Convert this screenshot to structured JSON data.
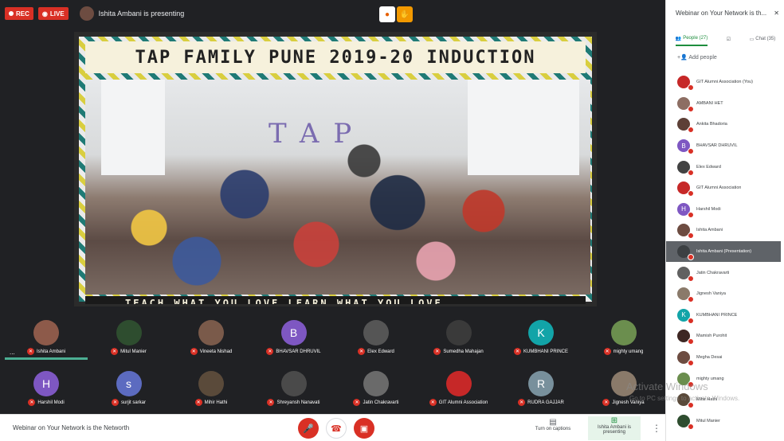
{
  "topbar": {
    "rec_label": "REC",
    "live_label": "LIVE",
    "presenter_text": "Ishita Ambani is presenting"
  },
  "slide": {
    "title": "TAP FAMILY PUNE 2019-20 INDUCTION",
    "footer": "TEACH WHAT YOU LOVE    LEARN WHAT YOU LOVE",
    "photo_sign": "TAP"
  },
  "filmstrip": {
    "row1": [
      {
        "name": "Ishita Ambani",
        "initial": "",
        "color": "#8d5a4a"
      },
      {
        "name": "Mitul Manier",
        "initial": "",
        "color": "#2e4d2f"
      },
      {
        "name": "Vineeta Nishad",
        "initial": "",
        "color": "#7a5a4a"
      },
      {
        "name": "BHAVSAR DHRUVIL",
        "initial": "B",
        "color": "#7e57c2"
      },
      {
        "name": "Elex Edward",
        "initial": "",
        "color": "#555555"
      },
      {
        "name": "Sumedha Mahajan",
        "initial": "",
        "color": "#3a3a3a"
      },
      {
        "name": "KUMBHANI PRINCE",
        "initial": "K",
        "color": "#12a4a8"
      },
      {
        "name": "mighty umang",
        "initial": "",
        "color": "#6b8e4e"
      }
    ],
    "row2": [
      {
        "name": "Harshil Modi",
        "initial": "H",
        "color": "#7e57c2"
      },
      {
        "name": "surjit sarkar",
        "initial": "s",
        "color": "#5c6bc0"
      },
      {
        "name": "Mihir Hathi",
        "initial": "",
        "color": "#5a4a3a"
      },
      {
        "name": "Shreyansh Nanavati",
        "initial": "",
        "color": "#4a4a4a"
      },
      {
        "name": "Jatin Chakravarti",
        "initial": "",
        "color": "#6a6a6a"
      },
      {
        "name": "GIT Alumni Association",
        "initial": "",
        "color": "#c62828"
      },
      {
        "name": "RUDRA GAJJAR",
        "initial": "R",
        "color": "#78909c"
      },
      {
        "name": "Jignesh Vaniya",
        "initial": "",
        "color": "#8a7a6a"
      }
    ],
    "more_text": "..."
  },
  "bottombar": {
    "meeting_title": "Webinar on Your Network is the Networth",
    "captions_label": "Turn on captions",
    "presenting_label": "Ishita Ambani is presenting"
  },
  "panel": {
    "title": "Webinar on Your Network is th...",
    "people_tab": "People (27)",
    "chat_tab": "Chat (35)",
    "add_people": "Add people",
    "people": [
      {
        "name": "GIT Alumni Association (You)",
        "initial": "",
        "color": "#c62828"
      },
      {
        "name": "AMBANI HET",
        "initial": "",
        "color": "#8d6e63"
      },
      {
        "name": "Ankita Bhadoria",
        "initial": "",
        "color": "#5d4037"
      },
      {
        "name": "BHAVSAR DHRUVIL",
        "initial": "B",
        "color": "#7e57c2"
      },
      {
        "name": "Elex Edward",
        "initial": "",
        "color": "#424242"
      },
      {
        "name": "GIT Alumni Association",
        "initial": "",
        "color": "#c62828"
      },
      {
        "name": "Harshil Modi",
        "initial": "H",
        "color": "#7e57c2"
      },
      {
        "name": "Ishita Ambani",
        "initial": "",
        "color": "#6d4c41"
      },
      {
        "name": "Ishita Ambani (Presentation)",
        "initial": "",
        "color": "#3c4043"
      },
      {
        "name": "Jatin Chakravarti",
        "initial": "",
        "color": "#616161"
      },
      {
        "name": "Jignesh Vaniya",
        "initial": "",
        "color": "#8a7a6a"
      },
      {
        "name": "KUMBHANI PRINCE",
        "initial": "K",
        "color": "#12a4a8"
      },
      {
        "name": "Mamish Purohit",
        "initial": "",
        "color": "#3e2723"
      },
      {
        "name": "Megha Desai",
        "initial": "",
        "color": "#6d4c41"
      },
      {
        "name": "mighty umang",
        "initial": "",
        "color": "#6b8e4e"
      },
      {
        "name": "Mihir Hathi",
        "initial": "",
        "color": "#5a4a3a"
      },
      {
        "name": "Mitul Manier",
        "initial": "",
        "color": "#2e4d2f"
      }
    ]
  },
  "watermark": {
    "line1": "Activate Windows",
    "line2": "Go to PC settings to activate Windows."
  }
}
